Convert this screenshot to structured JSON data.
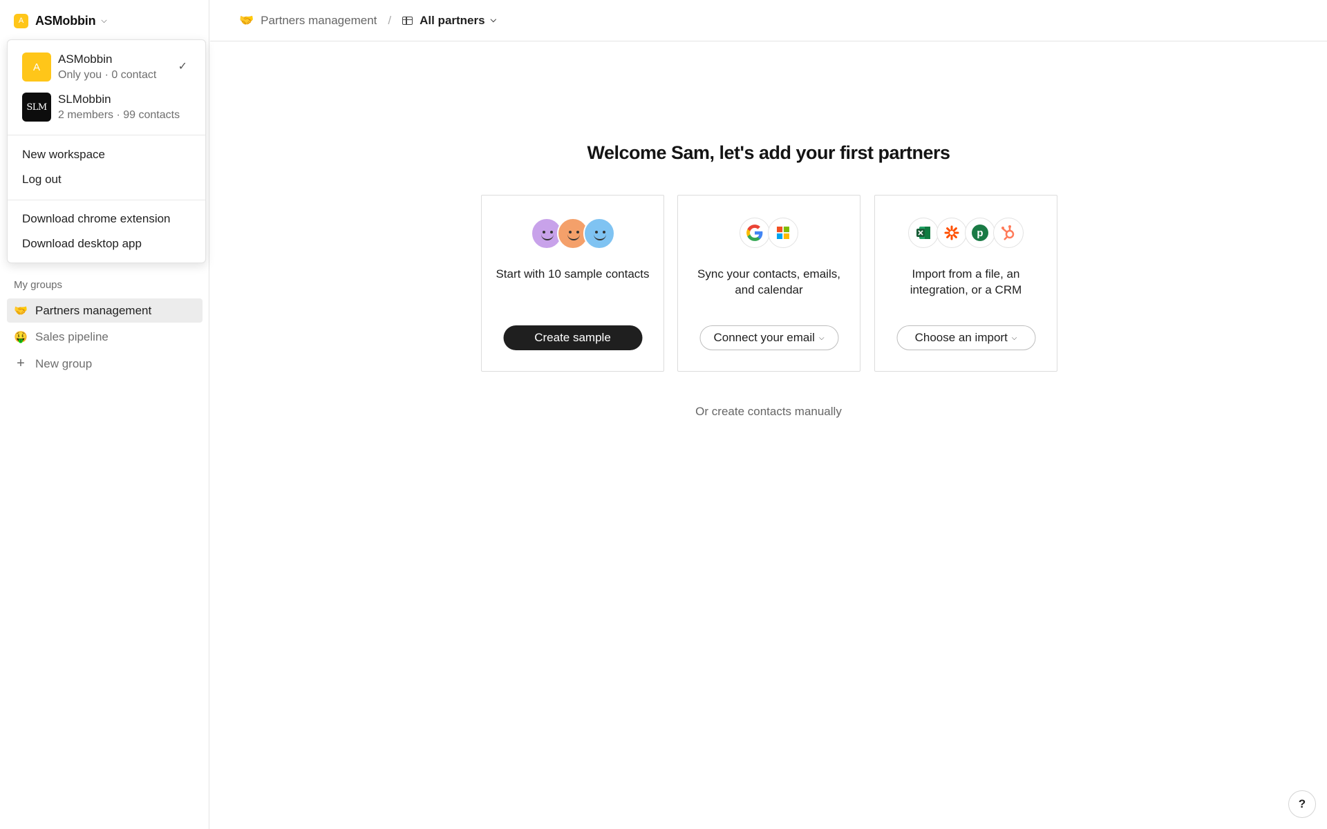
{
  "workspace": {
    "current_name": "ASMobbin",
    "current_logo_letter": "A"
  },
  "dropdown": {
    "workspaces": [
      {
        "name": "ASMobbin",
        "meta": "Only you · 0 contact",
        "logo": "A",
        "selected": true
      },
      {
        "name": "SLMobbin",
        "meta": "2 members · 99 contacts",
        "logo": "SLM",
        "selected": false
      }
    ],
    "actions": [
      "New workspace",
      "Log out"
    ],
    "downloads": [
      "Download chrome extension",
      "Download desktop app"
    ]
  },
  "sidebar": {
    "section_label": "My groups",
    "groups": [
      {
        "emoji": "🤝",
        "label": "Partners management",
        "active": true
      },
      {
        "emoji": "🤑",
        "label": "Sales pipeline",
        "active": false
      }
    ],
    "new_group_label": "New group"
  },
  "topbar": {
    "group_emoji": "🤝",
    "group_label": "Partners management",
    "separator": "/",
    "view_label": "All partners"
  },
  "main": {
    "welcome": "Welcome Sam, let's add your first partners",
    "cards": [
      {
        "text": "Start with 10 sample contacts",
        "button": "Create sample"
      },
      {
        "text": "Sync your contacts, emails, and calendar",
        "button": "Connect your email"
      },
      {
        "text": "Import from a file, an integration, or a CRM",
        "button": "Choose an import"
      }
    ],
    "manual_link": "Or create contacts manually"
  },
  "help_label": "?",
  "colors": {
    "brand_yellow": "#ffc619",
    "dark_button": "#1f1f1f",
    "active_row": "#ececec"
  }
}
